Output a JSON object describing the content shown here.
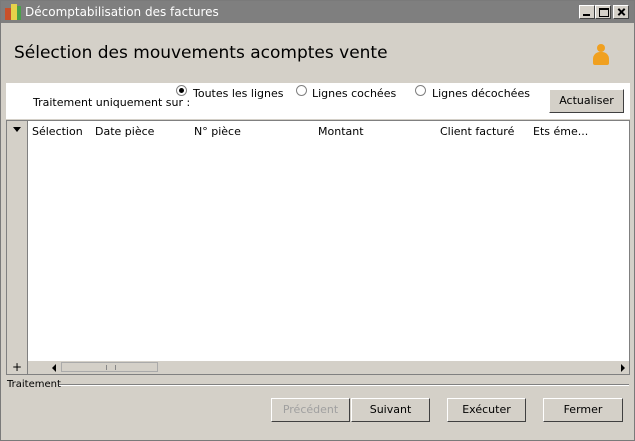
{
  "window": {
    "title": "Décomptabilisation des factures"
  },
  "header": {
    "title": "Sélection des mouvements acomptes vente"
  },
  "filter": {
    "label": "Traitement uniquement sur :",
    "options": [
      {
        "label": "Toutes les lignes",
        "checked": true
      },
      {
        "label": "Lignes cochées",
        "checked": false
      },
      {
        "label": "Lignes décochées",
        "checked": false
      }
    ],
    "refresh_label": "Actualiser"
  },
  "grid": {
    "columns": [
      "Sélection",
      "Date pièce",
      "N° pièce",
      "Montant",
      "Client facturé",
      "Ets éme..."
    ],
    "add_symbol": "+"
  },
  "footer": {
    "section_label": "Traitement",
    "buttons": {
      "previous": "Précédent",
      "next": "Suivant",
      "execute": "Exécuter",
      "close": "Fermer"
    }
  }
}
